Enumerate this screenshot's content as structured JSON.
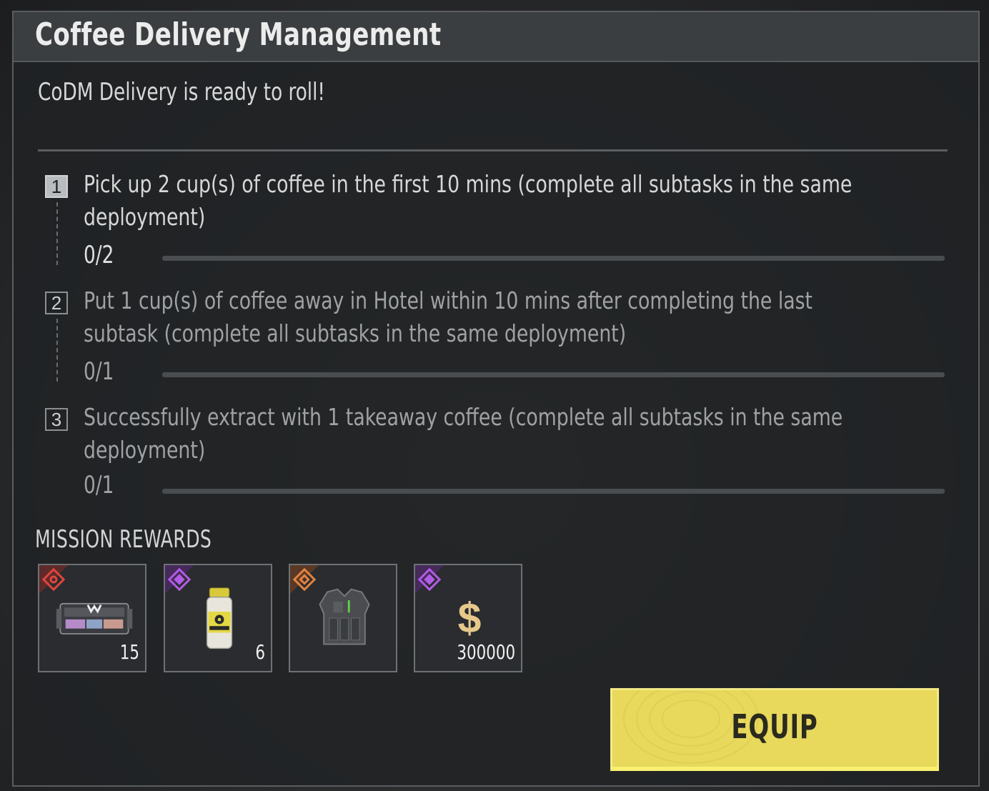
{
  "dialog": {
    "title": "Coffee Delivery Management",
    "subtitle": "CoDM Delivery is ready to roll!"
  },
  "tasks": [
    {
      "number": "1",
      "text": "Pick up 2 cup(s) of coffee in the first 10 mins (complete all subtasks in the same deployment)",
      "progress_text": "0/2",
      "progress": 0,
      "active": true
    },
    {
      "number": "2",
      "text": "Put 1 cup(s) of coffee away in Hotel within 10 mins after completing the last subtask (complete all subtasks in the same deployment)",
      "progress_text": "0/1",
      "progress": 0,
      "active": false
    },
    {
      "number": "3",
      "text": "Successfully extract with 1 takeaway coffee (complete all subtasks in the same deployment)",
      "progress_text": "0/1",
      "progress": 0,
      "active": false
    }
  ],
  "rewards": {
    "title": "MISSION REWARDS",
    "items": [
      {
        "icon": "weapon-case-icon",
        "rarity": "red",
        "rarity_color": "#d9463e",
        "quantity": "15"
      },
      {
        "icon": "iodine-bottle-icon",
        "rarity": "purple",
        "rarity_color": "#a24ad6",
        "quantity": "6"
      },
      {
        "icon": "armor-vest-icon",
        "rarity": "orange",
        "rarity_color": "#e07a3a",
        "quantity": ""
      },
      {
        "icon": "cash-dollar-icon",
        "rarity": "purple",
        "rarity_color": "#a24ad6",
        "quantity": "300000"
      }
    ]
  },
  "actions": {
    "equip_label": "EQUIP",
    "equip_color": "#e8d85c"
  }
}
